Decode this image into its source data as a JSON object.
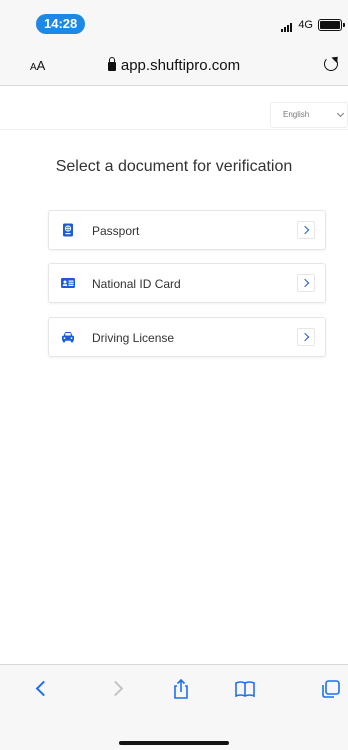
{
  "status_bar": {
    "time": "14:28",
    "network": "4G"
  },
  "browser": {
    "text_size_small": "A",
    "text_size_large": "A",
    "url": "app.shuftipro.com"
  },
  "page": {
    "language": "English",
    "heading": "Select a document for verification",
    "documents": [
      {
        "label": "Passport",
        "icon": "passport-icon"
      },
      {
        "label": "National ID Card",
        "icon": "id-card-icon"
      },
      {
        "label": "Driving License",
        "icon": "car-icon"
      }
    ]
  },
  "toolbar": {
    "icons": [
      "back-icon",
      "forward-icon",
      "share-icon",
      "bookmarks-icon",
      "tabs-icon"
    ]
  },
  "colors": {
    "accent": "#1e5bd8",
    "status_pill": "#1e88e5",
    "toolbar_active": "#1e6ff0"
  }
}
